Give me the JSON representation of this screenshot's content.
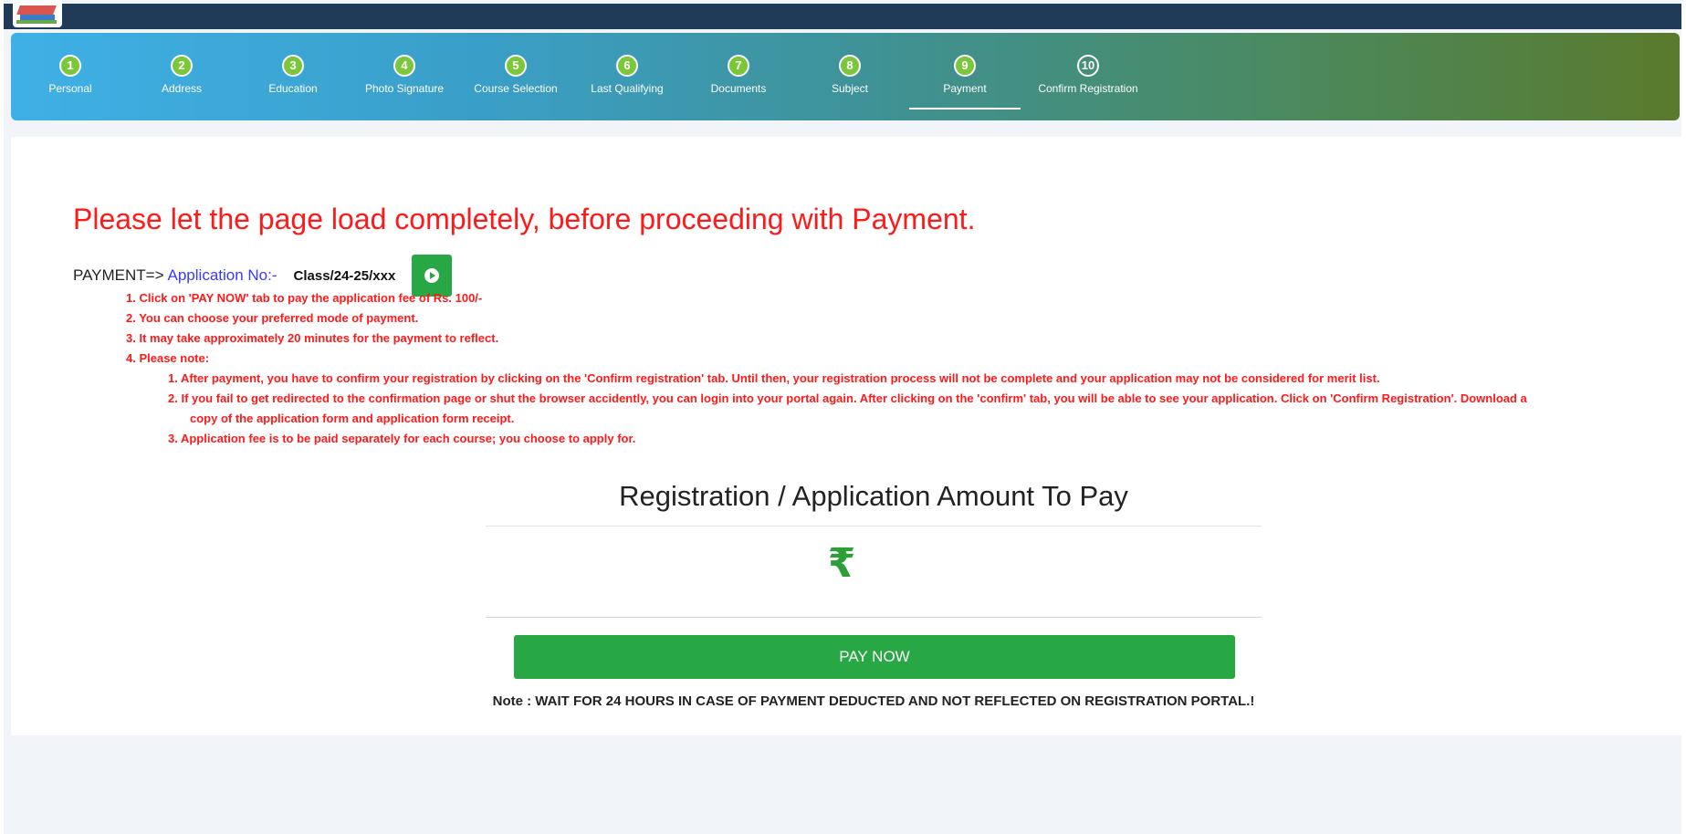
{
  "header": {
    "logo_icon": "institution-logo-icon"
  },
  "steps": [
    {
      "number": "1",
      "label": "Personal"
    },
    {
      "number": "2",
      "label": "Address"
    },
    {
      "number": "3",
      "label": "Education"
    },
    {
      "number": "4",
      "label": "Photo Signature"
    },
    {
      "number": "5",
      "label": "Course Selection"
    },
    {
      "number": "6",
      "label": "Last Qualifying"
    },
    {
      "number": "7",
      "label": "Documents"
    },
    {
      "number": "8",
      "label": "Subject"
    },
    {
      "number": "9",
      "label": "Payment"
    },
    {
      "number": "10",
      "label": "Confirm Registration"
    }
  ],
  "payment": {
    "warning": "Please let the page load completely, before proceeding with Payment.",
    "prefix": "PAYMENT=>",
    "app_label": "Application No:-",
    "app_number": "Class/24-25/xxx",
    "instructions": [
      "1. Click on 'PAY NOW' tab to pay the application fee of Rs. 100/-",
      "2. You can choose your preferred mode of payment.",
      "3. It may take approximately 20 minutes for the payment to reflect.",
      "4. Please note:"
    ],
    "notes": [
      "1. After payment, you have to confirm your registration by clicking on the 'Confirm registration' tab. Until then, your registration process will not be complete and your application may not be considered for merit list.",
      "2. If you fail to get redirected to the confirmation page or shut the browser accidently, you can login into your portal again. After clicking on the 'confirm' tab, you will be able to see your application. Click on 'Confirm Registration'. Download a",
      "copy of the application form and application form receipt.",
      "3. Application fee is to be paid separately for each course; you choose to apply for."
    ],
    "amount_title": "Registration / Application Amount To Pay",
    "currency_symbol": "₹",
    "pay_button": "PAY NOW",
    "footer_note": "Note : WAIT FOR 24 HOURS IN CASE OF PAYMENT DEDUCTED AND NOT REFLECTED ON REGISTRATION PORTAL.!"
  },
  "colors": {
    "warning": "#ff1a1a",
    "pay_button": "#28a745",
    "step_done": "#7cc63a",
    "topbar": "#1f3b57"
  }
}
